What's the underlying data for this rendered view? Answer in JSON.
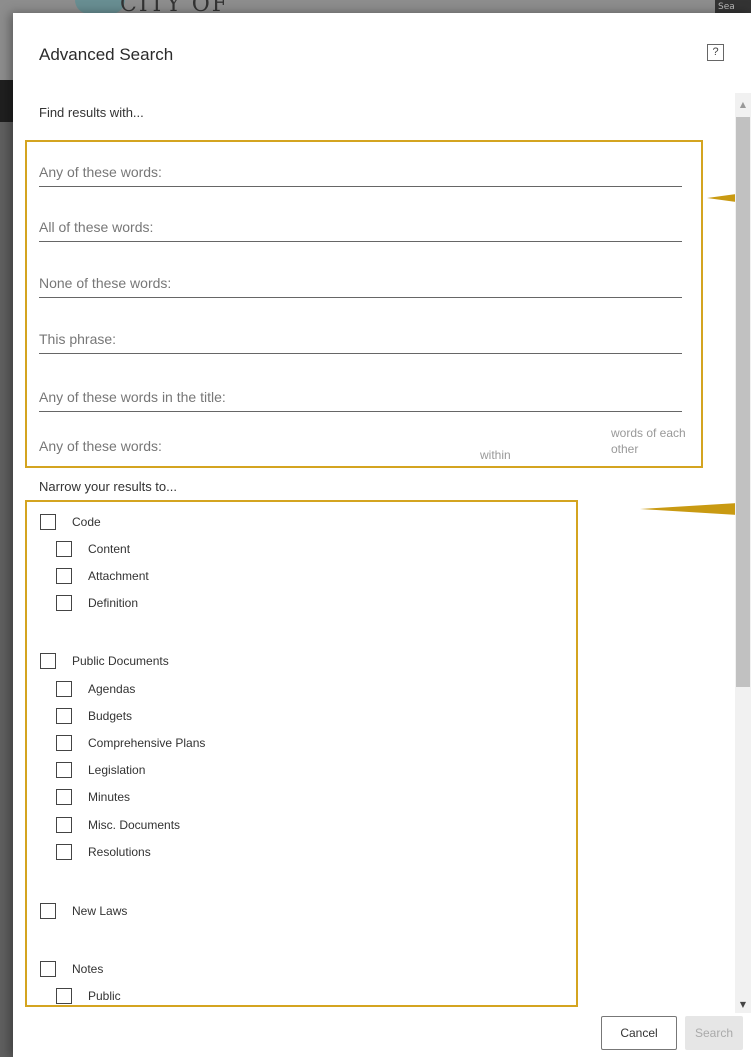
{
  "background": {
    "logo_text": "CITY OF",
    "search_label": "Sea"
  },
  "dialog": {
    "title": "Advanced Search",
    "help_label": "?"
  },
  "find_section": {
    "heading": "Find results with...",
    "fields": [
      {
        "placeholder": "Any of these words:"
      },
      {
        "placeholder": "All of these words:"
      },
      {
        "placeholder": "None of these words:"
      },
      {
        "placeholder": "This phrase:"
      },
      {
        "placeholder": "Any of these words in the title:"
      }
    ],
    "proximity": {
      "placeholder": "Any of these words:",
      "within_label": "within",
      "words_of_label": "words of each other"
    }
  },
  "narrow_section": {
    "heading": "Narrow your results to...",
    "groups": [
      {
        "label": "Code",
        "children": [
          "Content",
          "Attachment",
          "Definition"
        ]
      },
      {
        "label": "Public Documents",
        "children": [
          "Agendas",
          "Budgets",
          "Comprehensive Plans",
          "Legislation",
          "Minutes",
          "Misc. Documents",
          "Resolutions"
        ]
      },
      {
        "label": "New Laws",
        "children": []
      },
      {
        "label": "Notes",
        "children": [
          "Public"
        ]
      }
    ]
  },
  "buttons": {
    "cancel": "Cancel",
    "search": "Search"
  },
  "colors": {
    "highlight": "#d4a420",
    "callout": "#c99a12"
  }
}
